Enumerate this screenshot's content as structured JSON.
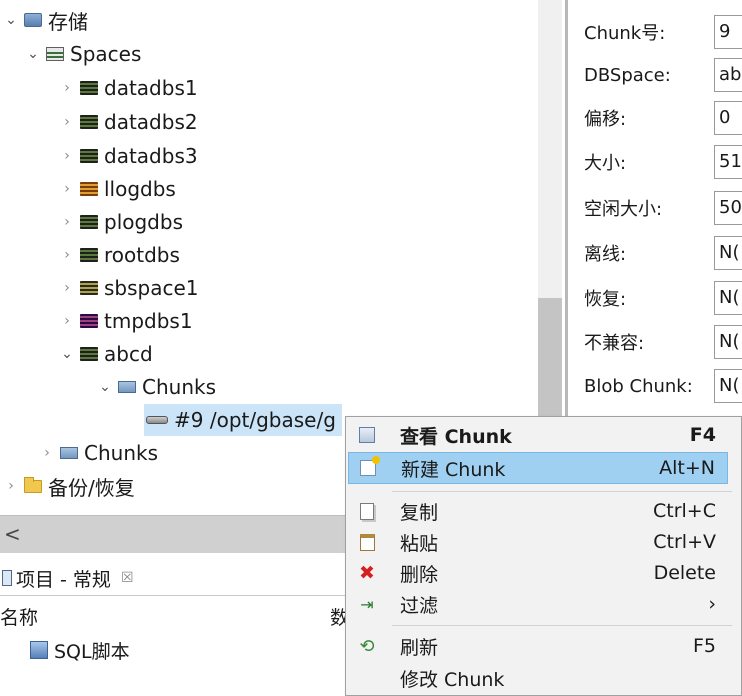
{
  "tree": {
    "nodes": [
      {
        "label": "存储",
        "icon": "storage-icon",
        "twisty": "open"
      },
      {
        "label": "Spaces",
        "icon": "spaces-icon",
        "twisty": "open"
      },
      {
        "label": "datadbs1",
        "icon": "dbspace-icon",
        "twisty": "closed"
      },
      {
        "label": "datadbs2",
        "icon": "dbspace-icon",
        "twisty": "closed"
      },
      {
        "label": "datadbs3",
        "icon": "dbspace-icon",
        "twisty": "closed"
      },
      {
        "label": "llogdbs",
        "icon": "dbspace-icon",
        "twisty": "closed"
      },
      {
        "label": "plogdbs",
        "icon": "dbspace-icon",
        "twisty": "closed"
      },
      {
        "label": "rootdbs",
        "icon": "dbspace-icon",
        "twisty": "closed"
      },
      {
        "label": "sbspace1",
        "icon": "sbspace-icon",
        "twisty": "closed"
      },
      {
        "label": "tmpdbs1",
        "icon": "tmpspace-icon",
        "twisty": "closed"
      },
      {
        "label": "abcd",
        "icon": "dbspace-icon",
        "twisty": "open"
      },
      {
        "label": "Chunks",
        "icon": "chunks-folder-icon",
        "twisty": "open"
      },
      {
        "label": "#9 /opt/gbase/g",
        "icon": "chunk-icon",
        "twisty": "none"
      },
      {
        "label": "Chunks",
        "icon": "chunks-folder-icon",
        "twisty": "closed"
      },
      {
        "label": "备份/恢复",
        "icon": "folder-icon",
        "twisty": "closed"
      }
    ]
  },
  "properties": {
    "rows": [
      {
        "label": "Chunk号:",
        "value": "9"
      },
      {
        "label": "DBSpace:",
        "value": "ab"
      },
      {
        "label": "偏移:",
        "value": "0"
      },
      {
        "label": "大小:",
        "value": "51"
      },
      {
        "label": "空闲大小:",
        "value": "50"
      },
      {
        "label": "离线:",
        "value": "N("
      },
      {
        "label": "恢复:",
        "value": "N("
      },
      {
        "label": "不兼容:",
        "value": "N("
      },
      {
        "label": "Blob Chunk:",
        "value": "N("
      }
    ]
  },
  "bottom_view": {
    "tab_label": "项目 - 常规",
    "tab_close": "☒",
    "column_name": "名称",
    "column_type_fragment": "数",
    "row_label": "SQL脚本"
  },
  "hscroll": {
    "left_arrow": "<"
  },
  "context_menu": {
    "items": [
      {
        "icon": "view-chunk-icon",
        "label": "查看 Chunk",
        "shortcut": "F4",
        "bold": true
      },
      {
        "icon": "new-chunk-icon",
        "label": "新建 Chunk",
        "shortcut": "Alt+N",
        "highlighted": true
      },
      {
        "icon": "copy-icon",
        "label": "复制",
        "shortcut": "Ctrl+C"
      },
      {
        "icon": "paste-icon",
        "label": "粘贴",
        "shortcut": "Ctrl+V"
      },
      {
        "icon": "delete-icon",
        "label": "删除",
        "shortcut": "Delete"
      },
      {
        "icon": "filter-icon",
        "label": "过滤",
        "shortcut": "›"
      },
      {
        "icon": "refresh-icon",
        "label": "刷新",
        "shortcut": "F5"
      },
      {
        "icon": "",
        "label": "修改 Chunk",
        "shortcut": ""
      }
    ]
  },
  "colors": {
    "selection": "#cce4f7",
    "menu_highlight": "#9fd0f2",
    "menu_bg": "#f2f2f2"
  }
}
